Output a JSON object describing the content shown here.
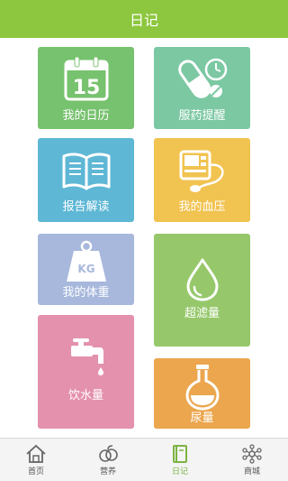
{
  "header": {
    "title": "日记"
  },
  "tiles": {
    "calendar": {
      "label": "我的日历",
      "date": "15",
      "icon": "calendar-icon"
    },
    "medicine": {
      "label": "服药提醒",
      "icon": "pill-clock-icon"
    },
    "report": {
      "label": "报告解读",
      "icon": "open-book-icon"
    },
    "pressure": {
      "label": "我的血压",
      "icon": "blood-pressure-monitor-icon"
    },
    "weight": {
      "label": "我的体重",
      "weight_unit": "KG",
      "icon": "weight-icon"
    },
    "ultrafiltration": {
      "label": "超滤量",
      "icon": "water-drop-icon"
    },
    "water": {
      "label": "饮水量",
      "icon": "faucet-icon"
    },
    "urine": {
      "label": "尿量",
      "icon": "flask-icon"
    }
  },
  "tabbar": {
    "items": [
      {
        "label": "首页",
        "icon": "home-icon",
        "active": false
      },
      {
        "label": "营养",
        "icon": "fruit-icon",
        "active": false
      },
      {
        "label": "日记",
        "icon": "diary-icon",
        "active": true
      },
      {
        "label": "商城",
        "icon": "network-icon",
        "active": false
      }
    ]
  },
  "colors": {
    "header": "#8dc63f",
    "calendar": "#77c26e",
    "medicine": "#7cc8a3",
    "report": "#5eb7d5",
    "pressure": "#f1c350",
    "weight": "#a7b8dc",
    "ultrafiltration": "#96c86b",
    "water": "#e491ae",
    "urine": "#eba64e",
    "tab_active": "#7cb342"
  }
}
